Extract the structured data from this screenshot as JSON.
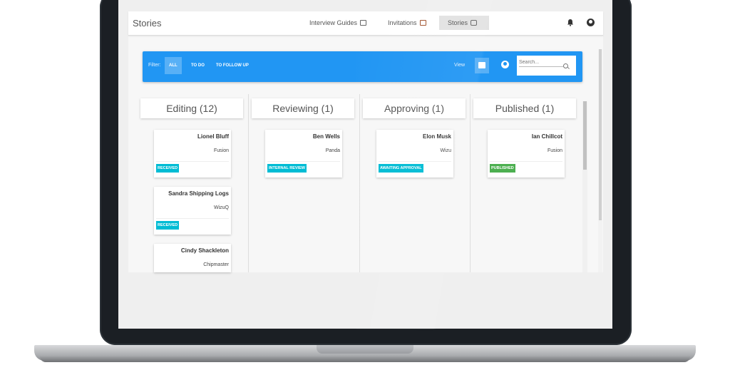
{
  "app": {
    "title": "Stories"
  },
  "nav": [
    {
      "label": "Interview Guides",
      "icon": "scroll-icon",
      "active": false
    },
    {
      "label": "Invitations",
      "icon": "envelope-icon",
      "active": false
    },
    {
      "label": "Stories",
      "icon": "chat-icon",
      "active": true
    }
  ],
  "filter": {
    "label": "Filter:",
    "options": [
      "ALL",
      "TO DO",
      "TO FOLLOW UP"
    ],
    "active": "ALL",
    "view_label": "View",
    "search_placeholder": "Search..."
  },
  "columns": [
    {
      "title": "Editing (12)",
      "cards": [
        {
          "name": "Lionel Bluff",
          "company": "Fusion",
          "status": "RECEIVED"
        },
        {
          "name": "Sandra Shipping Logs",
          "company": "WizuQ",
          "status": "RECEIVED"
        },
        {
          "name": "Cindy Shackleton",
          "company": "Chipmaster",
          "status": ""
        }
      ]
    },
    {
      "title": "Reviewing (1)",
      "cards": [
        {
          "name": "Ben Wells",
          "company": "Panda",
          "status": "INTERNAL REVIEW"
        }
      ]
    },
    {
      "title": "Approving (1)",
      "cards": [
        {
          "name": "Elon Musk",
          "company": "Wizu",
          "status": "AWAITING APPROVAL"
        }
      ]
    },
    {
      "title": "Published (1)",
      "cards": [
        {
          "name": "Ian Chillcot",
          "company": "Fusion",
          "status": "PUBLISHED"
        }
      ]
    }
  ],
  "colors": {
    "accent": "#2196f3",
    "status_received": "#00bcd4",
    "status_review": "#00bcd4",
    "status_published": "#4caf50"
  }
}
